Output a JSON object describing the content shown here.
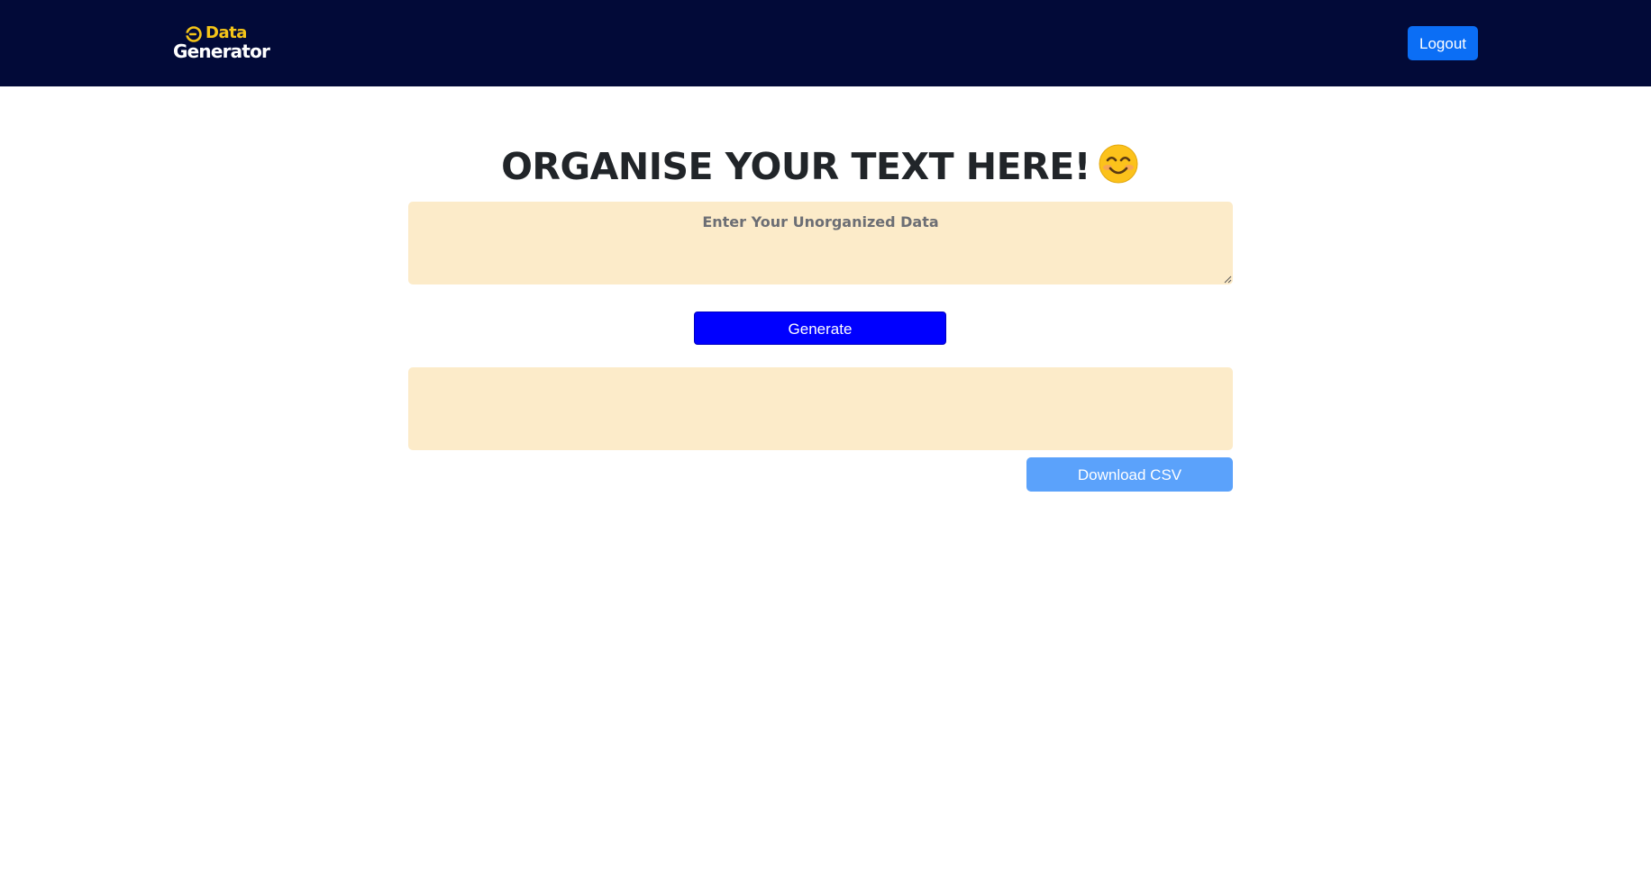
{
  "header": {
    "logo_top": "Data",
    "logo_bottom": "Generator",
    "logout_label": "Logout"
  },
  "main": {
    "title": "ORGANISE YOUR TEXT HERE!",
    "title_emoji_icon": "smiling-face-icon",
    "input_placeholder": "Enter Your Unorganized Data",
    "input_value": "",
    "generate_label": "Generate",
    "output_value": "",
    "download_label": "Download CSV"
  },
  "colors": {
    "navbar_bg": "#020a38",
    "logo_accent": "#f5c518",
    "logout_bg": "#0b6ef5",
    "textarea_bg": "#fcebc9",
    "generate_bg": "#0000ff",
    "download_bg": "#5ba2fb",
    "title_text": "#212529"
  }
}
